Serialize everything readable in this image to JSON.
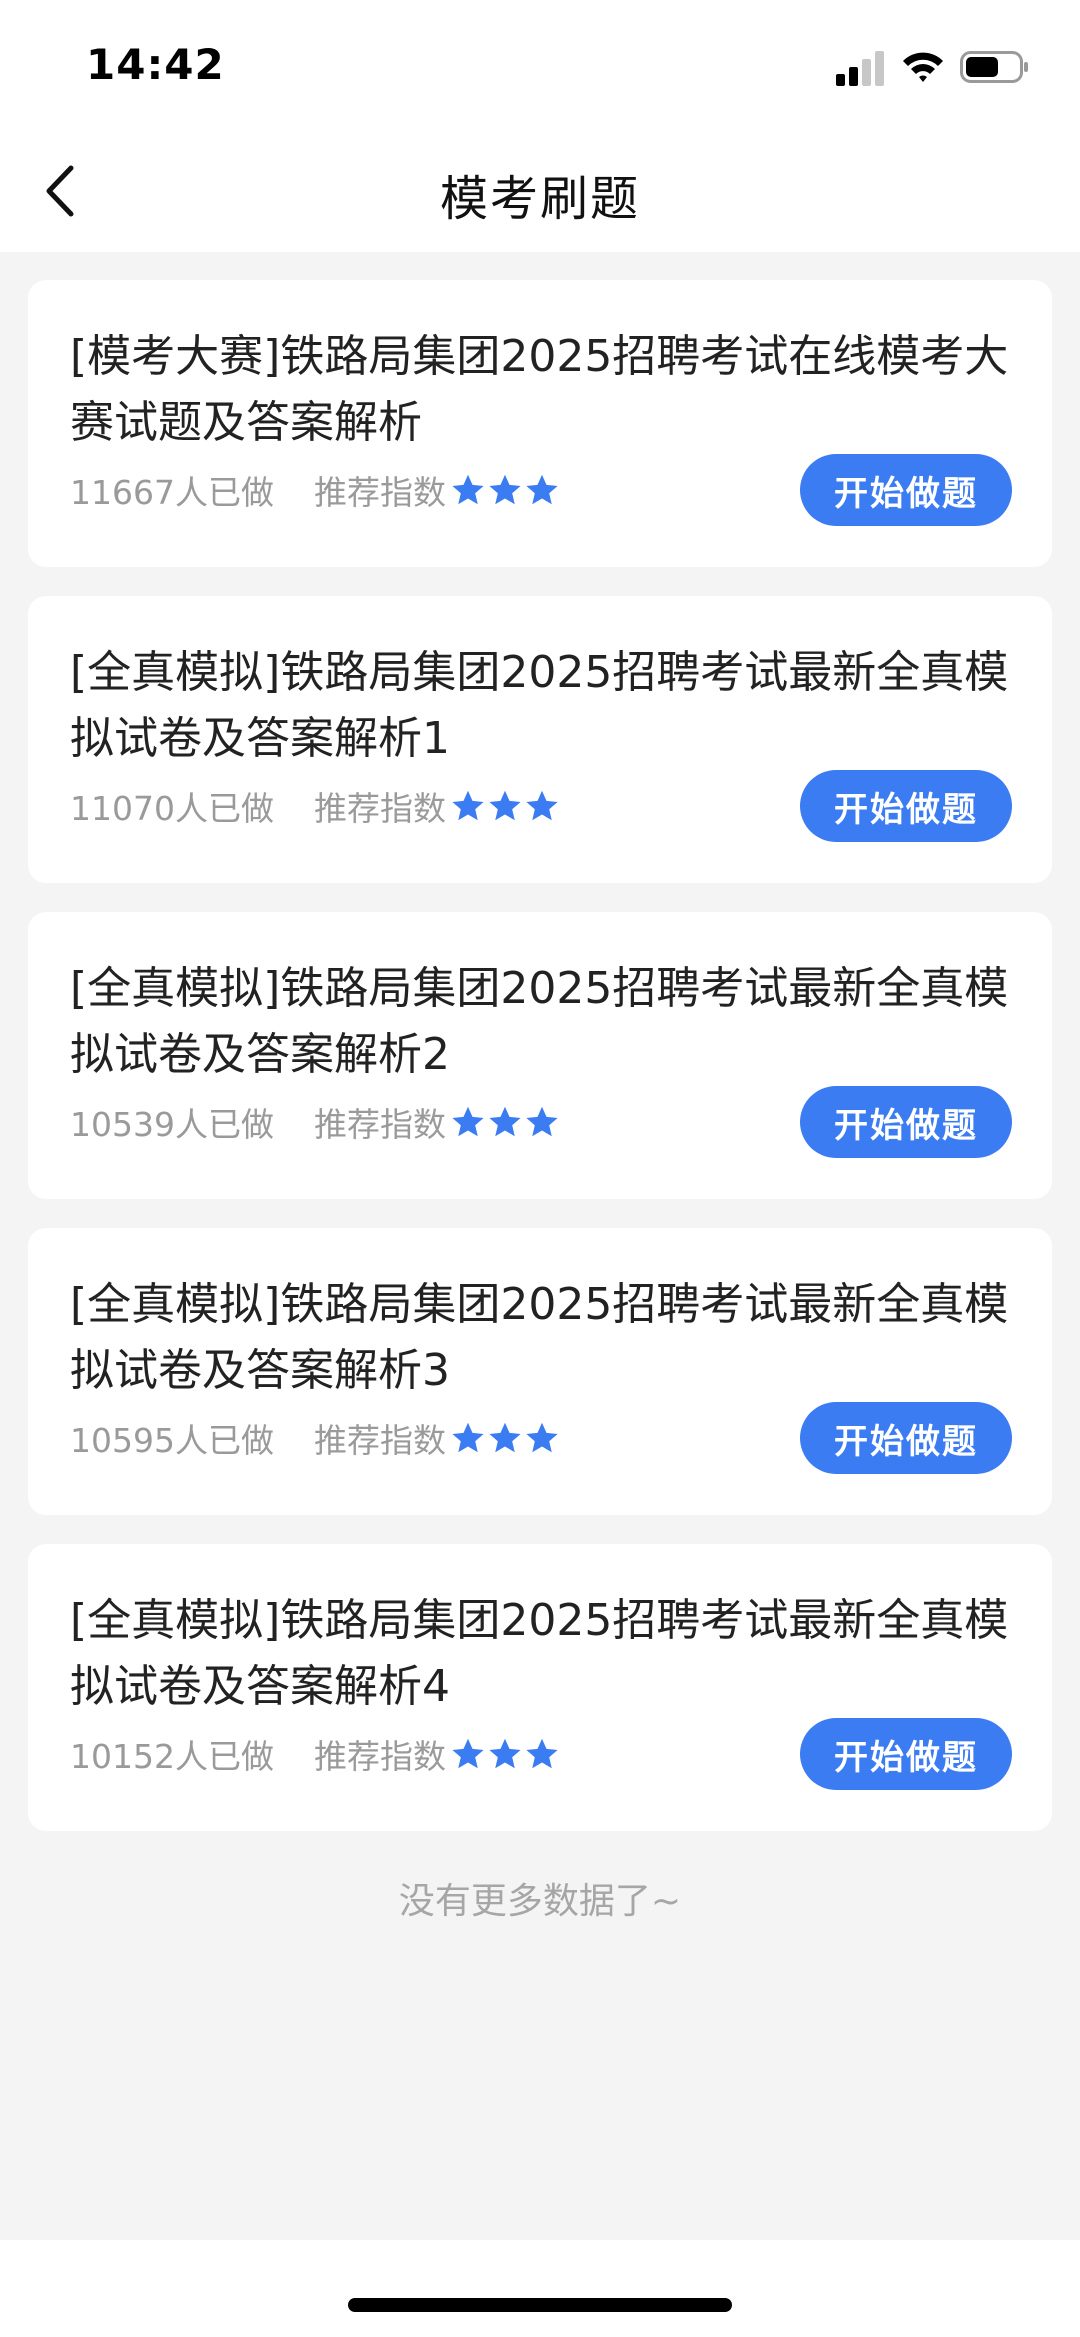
{
  "status_bar": {
    "time": "14:42"
  },
  "nav": {
    "title": "模考刷题"
  },
  "colors": {
    "accent": "#3b7cf2",
    "star": "#3b7cf2",
    "background": "#f4f4f5"
  },
  "items": [
    {
      "title": "[模考大赛]铁路局集团2025招聘考试在线模考大赛试题及答案解析",
      "count": "11667人已做",
      "rec_label": "推荐指数",
      "stars": 3,
      "button": "开始做题"
    },
    {
      "title": "[全真模拟]铁路局集团2025招聘考试最新全真模拟试卷及答案解析1",
      "count": "11070人已做",
      "rec_label": "推荐指数",
      "stars": 3,
      "button": "开始做题"
    },
    {
      "title": "[全真模拟]铁路局集团2025招聘考试最新全真模拟试卷及答案解析2",
      "count": "10539人已做",
      "rec_label": "推荐指数",
      "stars": 3,
      "button": "开始做题"
    },
    {
      "title": "[全真模拟]铁路局集团2025招聘考试最新全真模拟试卷及答案解析3",
      "count": "10595人已做",
      "rec_label": "推荐指数",
      "stars": 3,
      "button": "开始做题"
    },
    {
      "title": "[全真模拟]铁路局集团2025招聘考试最新全真模拟试卷及答案解析4",
      "count": "10152人已做",
      "rec_label": "推荐指数",
      "stars": 3,
      "button": "开始做题"
    }
  ],
  "footer": {
    "no_more": "没有更多数据了~"
  }
}
